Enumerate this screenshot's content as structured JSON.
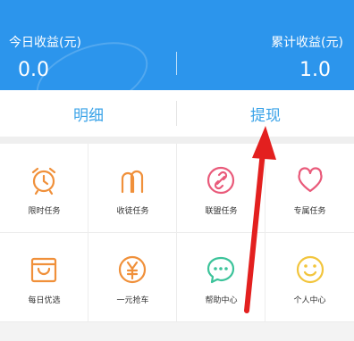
{
  "header": {
    "today_label": "今日收益(元)",
    "today_value": "0.0",
    "total_label": "累计收益(元)",
    "total_value": "1.0"
  },
  "tabs": {
    "details": "明细",
    "withdraw": "提现"
  },
  "grid": {
    "items": [
      {
        "label": "限时任务",
        "icon": "alarm-clock-icon"
      },
      {
        "label": "收徒任务",
        "icon": "people-icon"
      },
      {
        "label": "联盟任务",
        "icon": "link-icon"
      },
      {
        "label": "专属任务",
        "icon": "heart-icon"
      },
      {
        "label": "每日优选",
        "icon": "shopping-bag-icon"
      },
      {
        "label": "一元抢车",
        "icon": "yuan-coin-icon"
      },
      {
        "label": "帮助中心",
        "icon": "chat-bubble-icon"
      },
      {
        "label": "个人中心",
        "icon": "smiley-face-icon"
      }
    ]
  },
  "colors": {
    "header_blue": "#2c95ec",
    "tab_text": "#3aa3e8",
    "icon_orange": "#f0903a",
    "icon_pink": "#e95a7a",
    "icon_green": "#3cc39a",
    "icon_yellow": "#f2c53d",
    "annotation_red": "#e3201f"
  }
}
